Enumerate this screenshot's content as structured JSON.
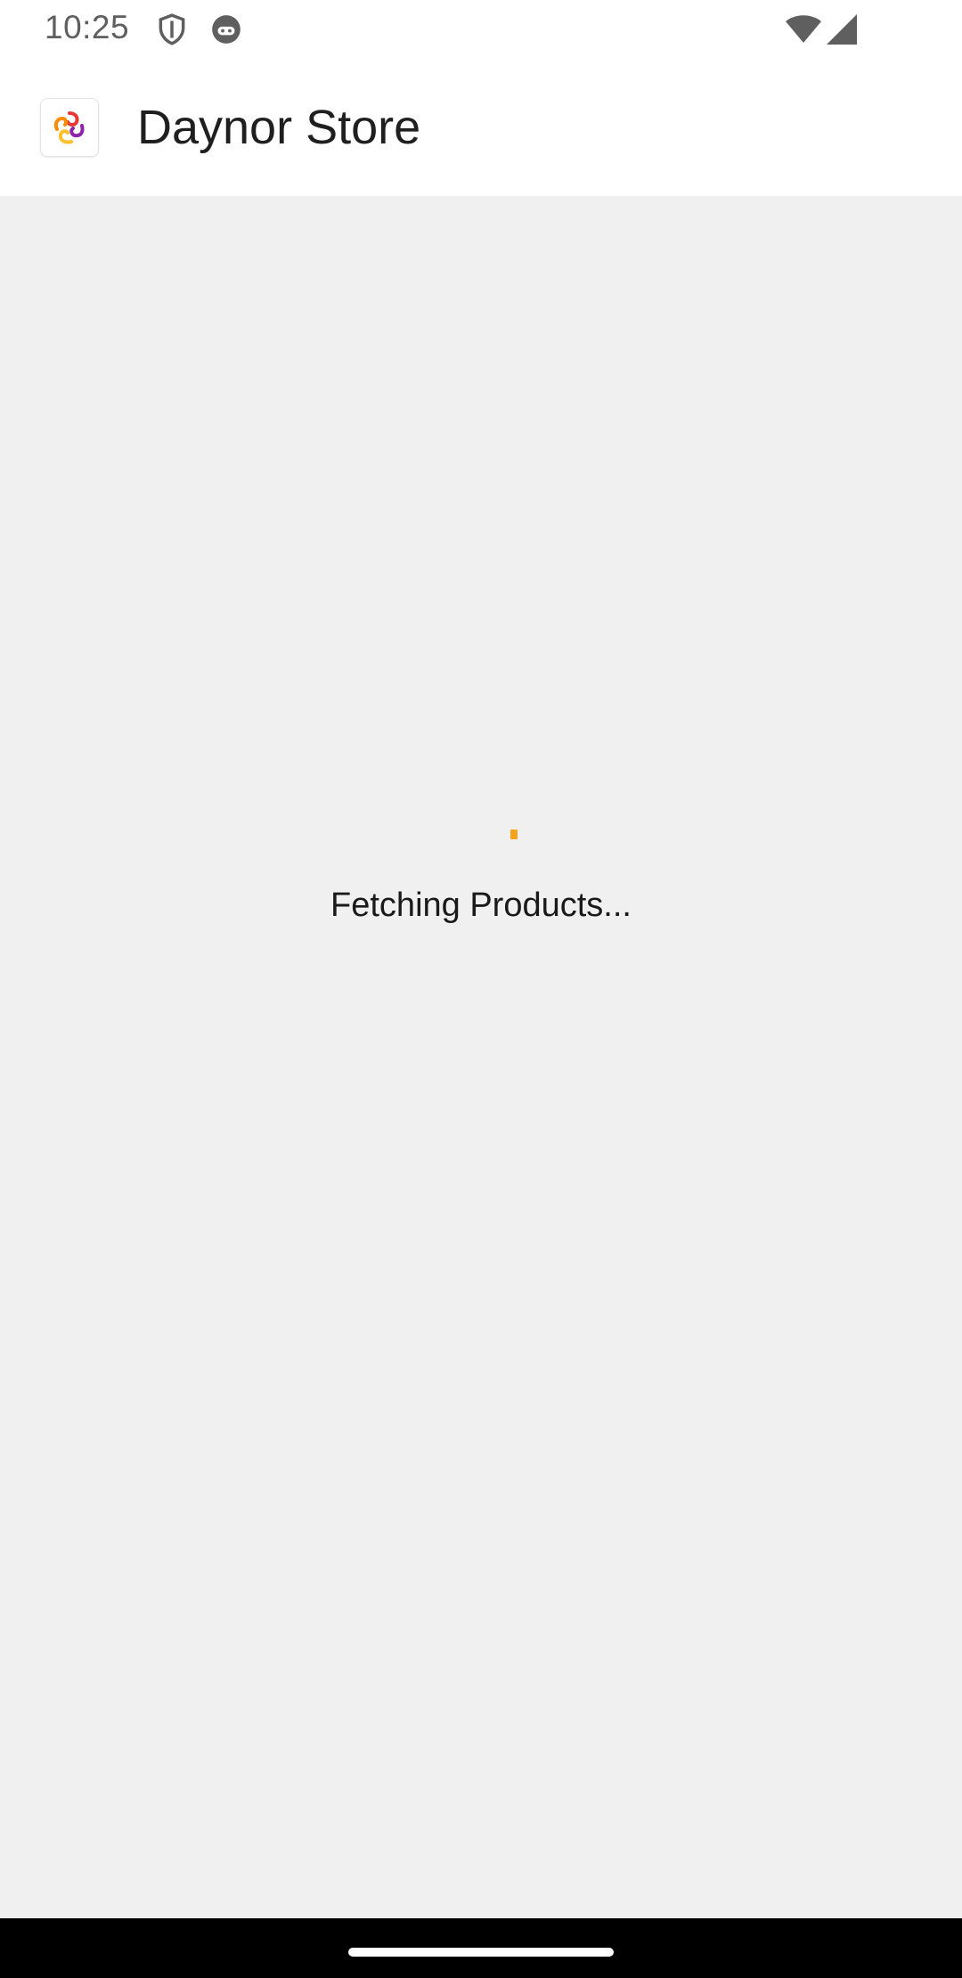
{
  "status_bar": {
    "time": "10:25",
    "icons": [
      "shield-icon",
      "android-bot-icon",
      "wifi-icon",
      "cell-signal-icon"
    ]
  },
  "app_bar": {
    "title": "Daynor Store",
    "logo_icon": "store-logo-icon"
  },
  "content": {
    "loading_text": "Fetching Products...",
    "spinner_color": "#f7a21b"
  },
  "colors": {
    "background": "#f0f0f0",
    "app_bar": "#ffffff",
    "accent": "#f7a21b",
    "nav_bar": "#000000"
  }
}
